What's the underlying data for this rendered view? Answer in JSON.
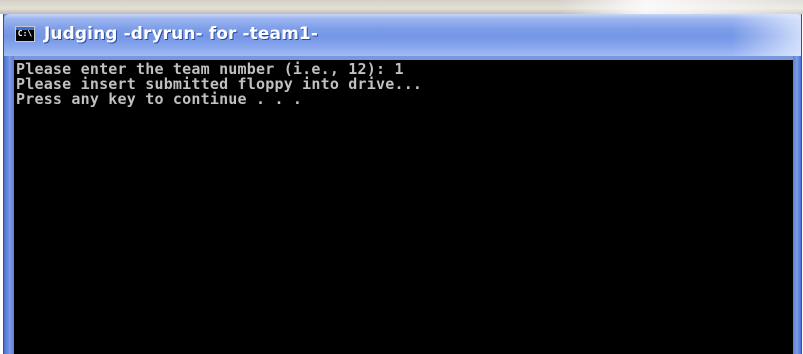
{
  "window": {
    "title": "Judging -dryrun- for -team1-",
    "icon": "cmd-console-icon",
    "icon_glyph": "C:\\"
  },
  "console": {
    "lines": [
      "Please enter the team number (i.e., 12): 1",
      "Please insert submitted floppy into drive...",
      "Press any key to continue . . ."
    ],
    "text_color": "#c0c0c0",
    "background_color": "#000000"
  },
  "colors": {
    "titlebar_blue": "#7396e6",
    "frame_blue": "#4a6fd0"
  }
}
